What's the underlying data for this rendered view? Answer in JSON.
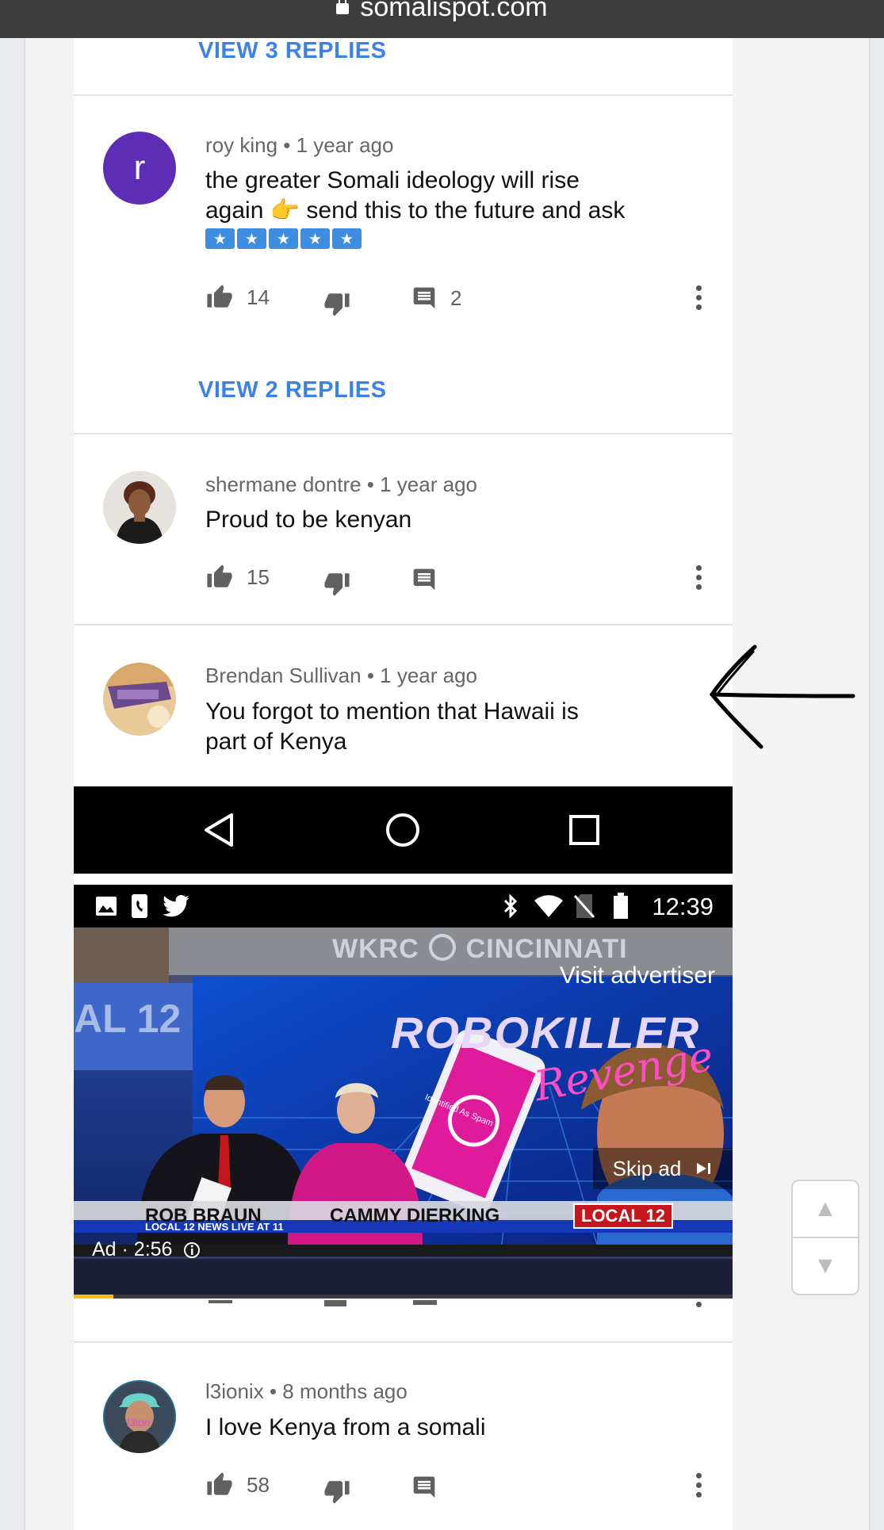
{
  "browser": {
    "url": "somalispot.com"
  },
  "comments": [
    {
      "view_replies": "VIEW 3 REPLIES"
    },
    {
      "avatar_letter": "r",
      "author": "roy king",
      "time": "1 year ago",
      "text_line1": "the greater Somali ideology will rise",
      "text_line2": "again 👉 send this to the future and ask",
      "likes": "14",
      "replies": "2",
      "view_replies": "VIEW 2 REPLIES"
    },
    {
      "author": "shermane dontre",
      "time": "1 year ago",
      "text": "Proud to be kenyan",
      "likes": "15"
    },
    {
      "author": "Brendan Sullivan",
      "time": "1 year ago",
      "text_line1": "You forgot to mention that Hawaii is",
      "text_line2": "part of Kenya"
    },
    {
      "author": "l3ionix",
      "time": "8 months ago",
      "text": "I love Kenya from a somali",
      "likes": "58"
    }
  ],
  "phone": {
    "status_time": "12:39"
  },
  "ad": {
    "channel_sign": "WKRC",
    "channel_city": "CINCINNATI",
    "visit_advertiser": "Visit advertiser",
    "product_title": "ROBOKILLER",
    "product_subtitle": "Revenge",
    "phone_label": "Identified As Spam",
    "skip_ad": "Skip ad",
    "anchor1": "ROB BRAUN",
    "anchor2": "CAMMY DIERKING",
    "station": "LOCAL 12",
    "ticker": "LOCAL 12 NEWS LIVE AT 11",
    "ad_timer": "Ad · 2:56",
    "studio_sign": "AL 12",
    "progress_fraction": 0.06
  },
  "colors": {
    "accent": "#3b82e6",
    "avatar_purple": "#5e2db5"
  },
  "icons": [
    "lock-icon",
    "thumbs-up-icon",
    "thumbs-down-icon",
    "reply-icon",
    "more-vert-icon",
    "back-icon",
    "home-icon",
    "recents-icon",
    "gallery-icon",
    "phone-icon",
    "twitter-icon",
    "bluetooth-icon",
    "wifi-icon",
    "no-sim-icon",
    "battery-icon",
    "skip-icon",
    "info-icon",
    "arrow-icon",
    "scroll-up-icon",
    "scroll-down-icon"
  ]
}
